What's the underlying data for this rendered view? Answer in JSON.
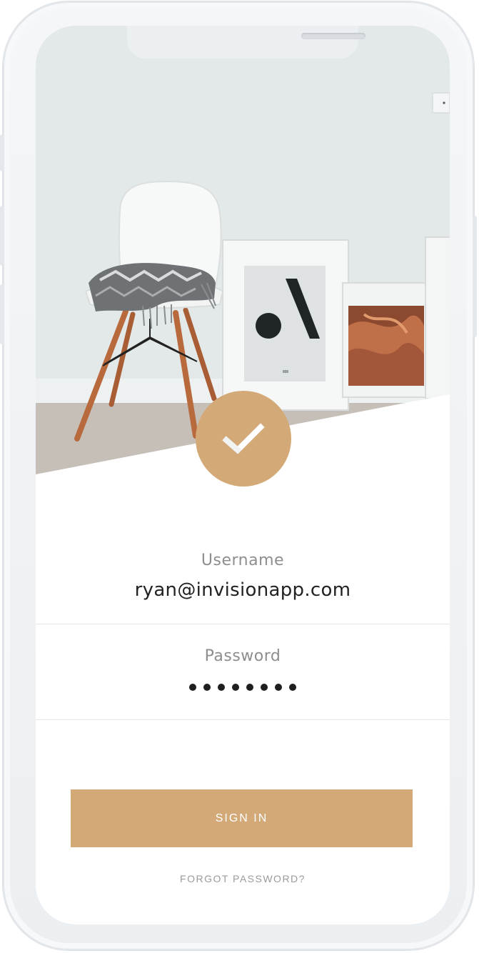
{
  "login": {
    "username_label": "Username",
    "username_value": "ryan@invisionapp.com",
    "password_label": "Password",
    "password_masked_length": 8,
    "signin_label": "SIGN IN",
    "forgot_label": "FORGOT PASSWORD?"
  },
  "icons": {
    "badge": "checkmark-icon"
  },
  "colors": {
    "accent": "#d3a977",
    "label": "#8e8e8e",
    "value": "#222222",
    "divider": "#e6e6e6",
    "wall": "#e3e8e9",
    "floor": "#c9c4be"
  }
}
